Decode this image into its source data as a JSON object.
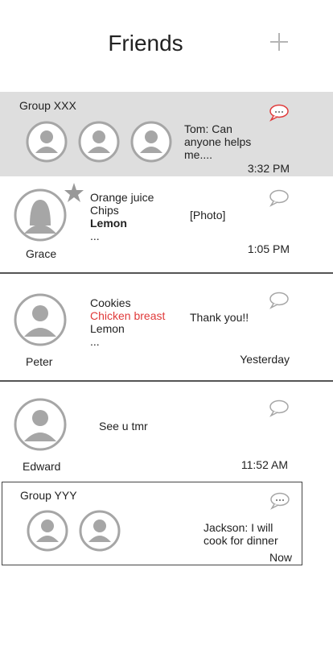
{
  "header": {
    "title": "Friends",
    "add_icon": "plus-icon"
  },
  "chats": {
    "group_xxx": {
      "title": "Group XXX",
      "message_lines": [
        "Tom: Can",
        "anyone helps",
        "me...."
      ],
      "time": "3:32 PM",
      "unread": true,
      "bubble_icon": "chat-bubble-dots-icon"
    },
    "grace": {
      "name": "Grace",
      "starred": true,
      "items": [
        "Orange juice",
        "Chips",
        "Lemon",
        "..."
      ],
      "message": "[Photo]",
      "time": "1:05 PM",
      "bubble_icon": "chat-bubble-icon"
    },
    "peter": {
      "name": "Peter",
      "items": [
        "Cookies",
        "Chicken breast",
        "Lemon",
        "..."
      ],
      "message": "Thank you!!",
      "time": "Yesterday",
      "bubble_icon": "chat-bubble-icon"
    },
    "edward": {
      "name": "Edward",
      "message": "See u tmr",
      "time": "11:52 AM",
      "bubble_icon": "chat-bubble-icon"
    },
    "group_yyy": {
      "title": "Group YYY",
      "message_lines": [
        "Jackson: I will",
        "cook for dinner"
      ],
      "time": "Now",
      "bubble_icon": "chat-bubble-dots-icon"
    }
  },
  "colors": {
    "accent_red": "#e03a3a",
    "group_bg": "#dedede",
    "avatar_gray": "#a6a6a6"
  }
}
